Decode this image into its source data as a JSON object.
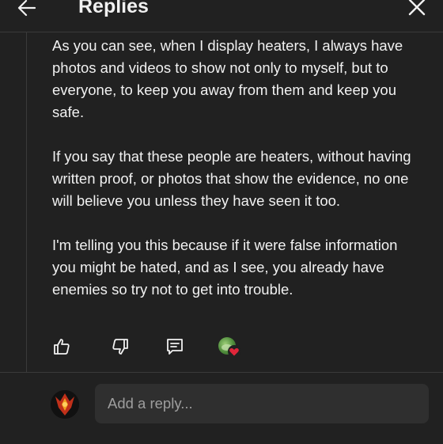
{
  "header": {
    "title": "Replies",
    "back_icon": "arrow-left-icon",
    "close_icon": "close-icon"
  },
  "comment": {
    "paragraphs": [
      "As you can see, when I display heaters, I always have photos and videos to show not only to myself, but to everyone, to keep you away from them and keep you safe.",
      "If you say that these people are heaters, without having written proof, or photos that show the evidence, no one will believe you unless they have seen it too.",
      "I'm telling you this because if it were false information you might be hated, and as I see, you already have enemies so try not to get into trouble."
    ]
  },
  "actions": {
    "icons": [
      "thumbs-up-icon",
      "thumbs-down-icon",
      "reply-comment-icon",
      "creator-heart-icon"
    ]
  },
  "reply_box": {
    "placeholder": "Add a reply..."
  },
  "colors": {
    "background": "#212121",
    "text": "#f1f1f1",
    "input_background": "#2f2f2f",
    "placeholder": "#9e9e9e",
    "heart": "#e0263a"
  }
}
